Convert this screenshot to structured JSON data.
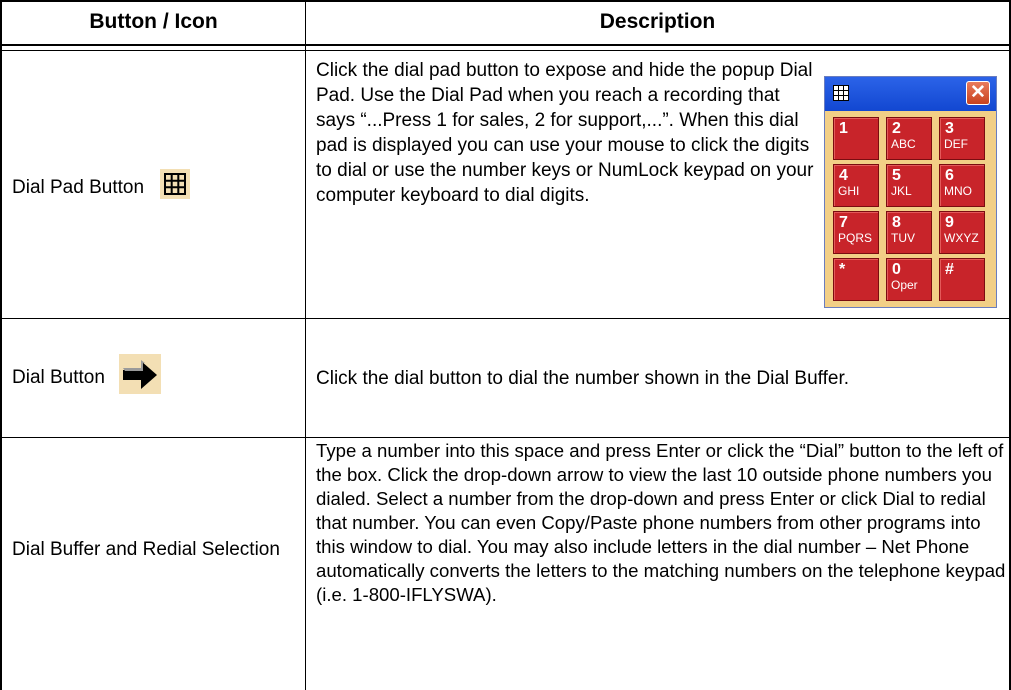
{
  "table": {
    "header": {
      "col1": "Button / Icon",
      "col2": "Description"
    },
    "rows": [
      {
        "label": "Dial Pad Button",
        "icon": "grid-icon",
        "description": "Click the dial pad button to expose and hide the popup Dial Pad.  Use the Dial Pad when you reach a recording that says “...Press 1 for sales, 2 for support,...”.   When this dial pad is displayed you can use your mouse to click the digits to dial or use the number keys or NumLock keypad on your computer keyboard to dial digits."
      },
      {
        "label": "Dial Button",
        "icon": "arrow-right-icon",
        "description": "Click the dial button to dial the number shown in the Dial Buffer."
      },
      {
        "label": "Dial Buffer and Redial Selection",
        "description": "Type a number into this space and press Enter or click the “Dial” button to the left of the box. Click the drop-down arrow to view the last 10 outside phone numbers you dialed.  Select a number from the drop-down and press Enter or click Dial to redial that number.  You can even Copy/Paste phone numbers from other programs into this window to dial.  You may also include letters in the dial number – Net Phone automatically converts the letters to the matching numbers on the telephone keypad (i.e. 1-800-IFLYSWA)."
      }
    ]
  },
  "dialpad": {
    "keys": [
      {
        "digit": "1",
        "letters": ""
      },
      {
        "digit": "2",
        "letters": "ABC"
      },
      {
        "digit": "3",
        "letters": "DEF"
      },
      {
        "digit": "4",
        "letters": "GHI"
      },
      {
        "digit": "5",
        "letters": "JKL"
      },
      {
        "digit": "6",
        "letters": "MNO"
      },
      {
        "digit": "7",
        "letters": "PQRS"
      },
      {
        "digit": "8",
        "letters": "TUV"
      },
      {
        "digit": "9",
        "letters": "WXYZ"
      },
      {
        "digit": "*",
        "letters": ""
      },
      {
        "digit": "0",
        "letters": "Oper"
      },
      {
        "digit": "#",
        "letters": ""
      }
    ],
    "colors": {
      "title_bar": "#1f57e0",
      "key": "#c8242a",
      "frame": "#f2cf86",
      "close": "#d9532f"
    }
  }
}
